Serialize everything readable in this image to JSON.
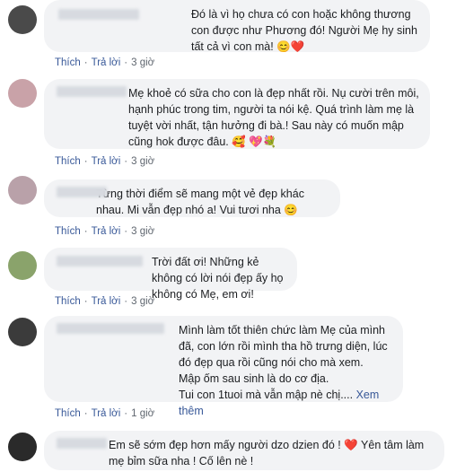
{
  "comments": [
    {
      "text": "Đó là vì họ chưa có con hoặc không thương con được như Phương đó! Người Mẹ hy sinh tất cả vì con mà! 😊❤️",
      "like": "Thích",
      "reply": "Trả lời",
      "time": "3 giờ",
      "avatar_color": "#4a4a4a"
    },
    {
      "text": "Mẹ khoẻ có sữa cho con là đẹp nhất rồi. Nụ cười trên môi, hạnh phúc trong tim, người ta nói kệ. Quá trình làm mẹ là tuyệt vời nhất, tận hưởng đi bà.! Sau này có muốn mập cũng hok được đâu. 🥰 💖💐",
      "like": "Thích",
      "reply": "Trả lời",
      "time": "3 giờ",
      "avatar_color": "#c9a2a8"
    },
    {
      "text": "Từng thời điểm sẽ mang một vẻ đẹp khác nhau. Mi vẫn đẹp nhó a! Vui tươi nha 😊",
      "like": "Thích",
      "reply": "Trả lời",
      "time": "3 giờ",
      "avatar_color": "#b9a1a9"
    },
    {
      "text": "Trời đất ơi! Những kẻ không có lời nói đẹp ấy họ không có Mẹ, em ơi!",
      "like": "Thích",
      "reply": "Trả lời",
      "time": "3 giờ",
      "avatar_color": "#8aa36b"
    },
    {
      "text": "Mình làm tốt thiên chức làm Mẹ của mình đã, con lớn rồi mình tha hồ trưng diện, lúc đó đẹp qua rồi cũng nói cho mà xem.\nMập ốm sau sinh là do cơ địa.\nTui con 1tuoi mà vẫn mập nè chị....",
      "see_more": "Xem thêm",
      "like": "Thích",
      "reply": "Trả lời",
      "time": "1 giờ",
      "avatar_color": "#3b3b3b"
    },
    {
      "text": "Em sẽ sớm đẹp hơn mấy người dzo dzien đó ! ❤️ Yên tâm làm mẹ bỉm sữa nha ! Cố lên nè !",
      "avatar_color": "#2a2a2a"
    }
  ]
}
